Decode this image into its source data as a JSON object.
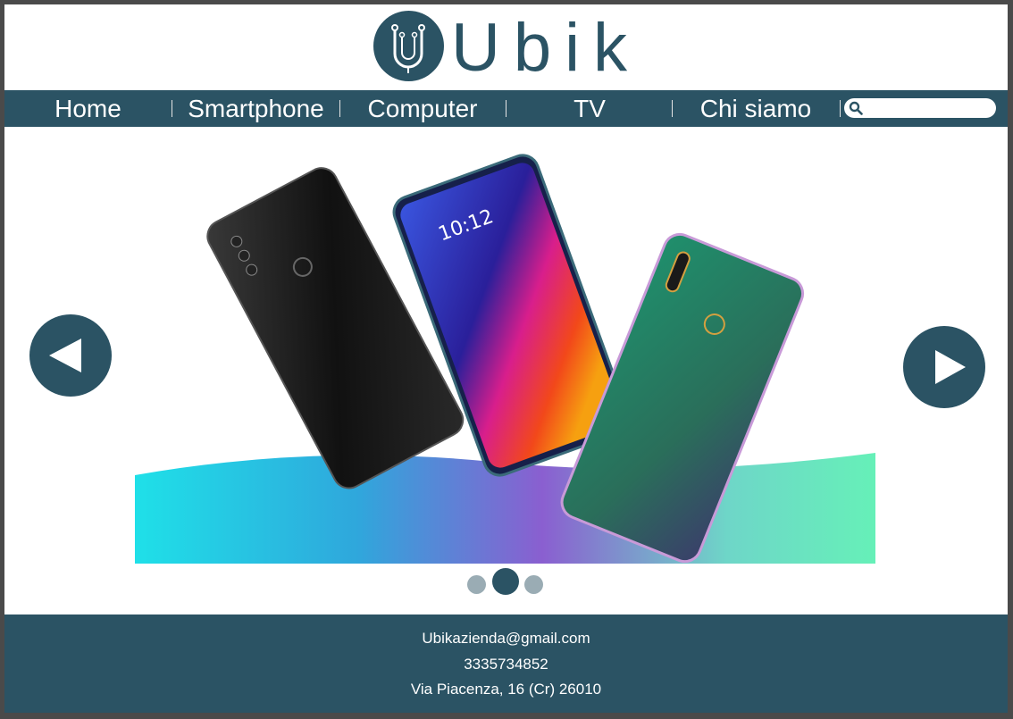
{
  "brand": {
    "name": "Ubik",
    "logo_icon": "u-circuit-logo-icon",
    "color": "#2b5364"
  },
  "nav": {
    "items": [
      {
        "label": "Home"
      },
      {
        "label": "Smartphone"
      },
      {
        "label": "Computer"
      },
      {
        "label": "TV"
      },
      {
        "label": "Chi siamo"
      }
    ],
    "search": {
      "icon": "search-icon",
      "placeholder": ""
    }
  },
  "slider": {
    "prev_icon": "triangle-left-icon",
    "next_icon": "triangle-right-icon",
    "image": "smartphones-banner",
    "slide_count": 3,
    "active_slide": 2,
    "phone_screen_time": "10:12"
  },
  "footer": {
    "email": "Ubikazienda@gmail.com",
    "phone": "3335734852",
    "address": "Via Piacenza, 16 (Cr) 26010"
  }
}
